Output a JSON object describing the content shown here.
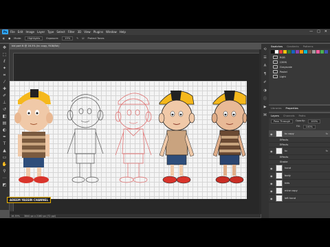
{
  "menu": {
    "logo": "Ps",
    "items": [
      "File",
      "Edit",
      "Image",
      "Layer",
      "Type",
      "Select",
      "Filter",
      "3D",
      "View",
      "Plugins",
      "Window",
      "Help"
    ],
    "window_controls": [
      "—",
      "□",
      "✕"
    ]
  },
  "options": {
    "mode_label": "Mode:",
    "mode_value": "Highlights",
    "exposure_label": "Exposure:",
    "exposure_value": "19%",
    "protect_label": "Protect Tones"
  },
  "document": {
    "tab_title": "kid part B @ 16.5% (kc copy, RGB/8#) *",
    "watermark": "ADEEM YASSIN CHANNEL",
    "status_zoom": "16.39%",
    "status_info": "3840 px x 2160 px (72 ppi)"
  },
  "swatches": {
    "tabs": [
      "Swatches",
      "Gradients",
      "Patterns"
    ],
    "colors": [
      "#111111",
      "#ffffff",
      "#e5393c",
      "#f1c40f",
      "#2e7d32",
      "#1565c0",
      "#8e44ad",
      "#ff9800",
      "#00bcd4",
      "#795548",
      "#9e9e9e",
      "#ff5f9e",
      "#4caf50",
      "#3f51b5"
    ],
    "groups": [
      "RGB",
      "CMYK",
      "Grayscale",
      "Pastel",
      "Light"
    ]
  },
  "properties": {
    "tabs": [
      "Libraries",
      "Properties"
    ]
  },
  "layers": {
    "tabs": [
      "Layers",
      "Channels",
      "Paths"
    ],
    "blend_mode": "Pass Through",
    "opacity_label": "Opacity:",
    "opacity_value": "100%",
    "fill_label": "Fill:",
    "fill_value": "100%",
    "items": [
      {
        "name": "kc copy",
        "sub": false,
        "selected": true,
        "fx": true
      },
      {
        "name": "Effects",
        "sub": true,
        "selected": false,
        "fx": false
      },
      {
        "name": "Effects",
        "sub": true,
        "selected": false,
        "fx": false
      },
      {
        "name": "kc",
        "sub": false,
        "selected": false,
        "fx": true
      },
      {
        "name": "Effects",
        "sub": true,
        "selected": false,
        "fx": false
      },
      {
        "name": "Stroke",
        "sub": true,
        "selected": false,
        "fx": false
      },
      {
        "name": "hand",
        "sub": false,
        "selected": false,
        "fx": false
      },
      {
        "name": "body",
        "sub": false,
        "selected": false,
        "fx": false
      },
      {
        "name": "kids",
        "sub": false,
        "selected": false,
        "fx": false
      },
      {
        "name": "mine copy",
        "sub": false,
        "selected": false,
        "fx": false
      },
      {
        "name": "left hand",
        "sub": false,
        "selected": false,
        "fx": false
      }
    ]
  },
  "colors": {
    "accent": "#31a8ff",
    "cap": "#f5b81c",
    "skin": "#f0c9a8",
    "sketch_red": "#e06666"
  }
}
